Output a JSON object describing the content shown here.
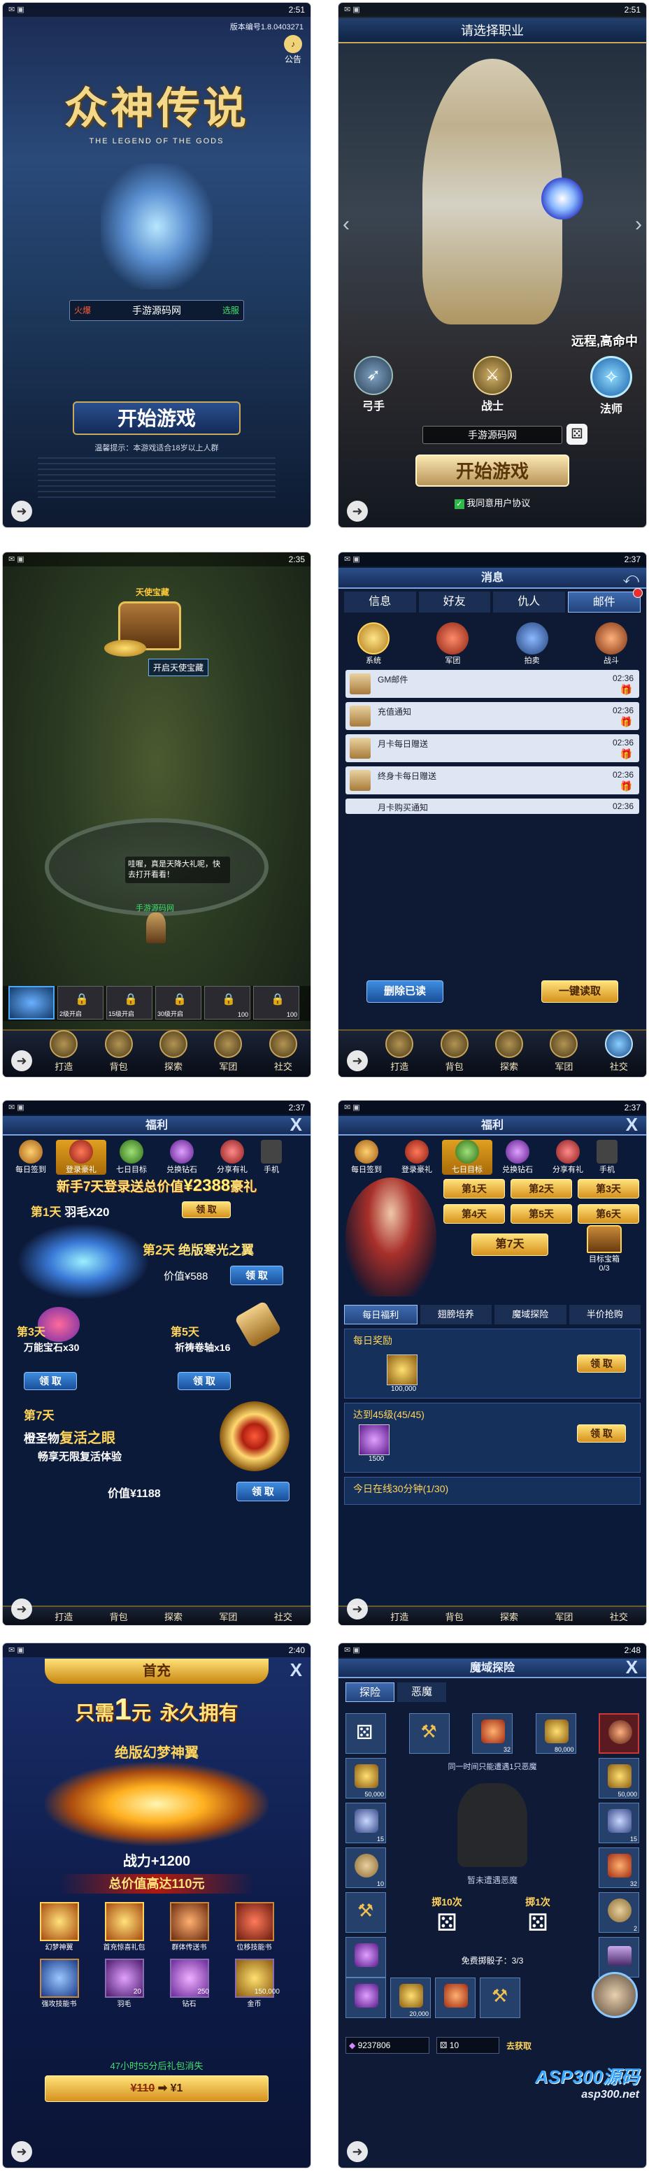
{
  "s1": {
    "time": "2:51",
    "version": "版本编号1.8.0403271",
    "notice": "公告",
    "logo_cn": "众神传说",
    "logo_en": "THE LEGEND OF THE GODS",
    "server_hot": "火爆",
    "server_name": "手游源码网",
    "server_switch": "选服",
    "start": "开始游戏",
    "tips": "温馨提示：本游戏适合18岁以上人群"
  },
  "s2": {
    "time": "2:51",
    "title": "请选择职业",
    "class_desc": "远程,高命中",
    "classes": [
      "弓手",
      "战士",
      "法师"
    ],
    "player_name": "手游源码网",
    "start": "开始游戏",
    "agree": "我同意用户协议"
  },
  "s3": {
    "time": "2:35",
    "chest_title": "天使宝藏",
    "chest_button": "开启天使宝藏",
    "npc_dialog": "哇喔，真是天降大礼呢，快去打开看看！",
    "player_name": "手游源码网",
    "skill_levels": [
      "",
      "2级开启",
      "15级开启",
      "30级开启",
      "100",
      "100"
    ],
    "bottom": [
      "打造",
      "背包",
      "探索",
      "军团",
      "社交"
    ]
  },
  "s4": {
    "time": "2:37",
    "title": "消息",
    "tabs": [
      "信息",
      "好友",
      "仇人",
      "邮件"
    ],
    "categories": [
      "系统",
      "军团",
      "拍卖",
      "战斗"
    ],
    "mails": [
      {
        "title": "GM邮件",
        "time": "02:36"
      },
      {
        "title": "充值通知",
        "time": "02:36"
      },
      {
        "title": "月卡每日赠送",
        "time": "02:36"
      },
      {
        "title": "终身卡每日赠送",
        "time": "02:36"
      },
      {
        "title": "月卡购买通知",
        "time": "02:36"
      }
    ],
    "delete_read": "删除已读",
    "read_all": "一键读取",
    "bottom": [
      "打造",
      "背包",
      "探索",
      "军团",
      "社交"
    ]
  },
  "s5": {
    "time": "2:37",
    "title": "福利",
    "tabs": [
      "每日签到",
      "登录豪礼",
      "七日目标",
      "兑换钻石",
      "分享有礼",
      "手机"
    ],
    "banner_prefix": "新手7天登录送总价值",
    "banner_value": "¥2388",
    "banner_suffix": "豪礼",
    "day1": "第1天",
    "day1_item": "羽毛X20",
    "claim": "领 取",
    "day2": "第2天",
    "day2_item": "绝版寒光之翼",
    "day2_price": "价值¥588",
    "day3": "第3天",
    "day3_item": "万能宝石x30",
    "day5": "第5天",
    "day5_item": "祈祷卷轴x16",
    "day7": "第7天",
    "day7_item1": "橙圣物",
    "day7_item2": "复活之眼",
    "day7_desc": "畅享无限复活体验",
    "day7_price": "价值¥1188",
    "bottom": [
      "打造",
      "背包",
      "探索",
      "军团",
      "社交"
    ]
  },
  "s6": {
    "time": "2:37",
    "title": "福利",
    "tabs": [
      "每日签到",
      "登录豪礼",
      "七日目标",
      "兑换钻石",
      "分享有礼",
      "手机"
    ],
    "days": [
      "第1天",
      "第2天",
      "第3天",
      "第4天",
      "第5天",
      "第6天"
    ],
    "day7": "第7天",
    "chest_label": "目标宝箱",
    "chest_count": "0/3",
    "subtabs": [
      "每日福利",
      "翅膀培养",
      "魔域探险",
      "半价抢购"
    ],
    "tasks": [
      {
        "title": "每日奖励",
        "qty": "100,000",
        "claim": "领 取"
      },
      {
        "title": "达到45级(45/45)",
        "qty": "1500",
        "claim": "领 取"
      },
      {
        "title": "今日在线30分钟(1/30)",
        "qty": "",
        "claim": ""
      }
    ],
    "bottom": [
      "打造",
      "背包",
      "探索",
      "军团",
      "社交"
    ]
  },
  "s7": {
    "time": "2:40",
    "title": "首充",
    "headline_a": "只需",
    "headline_num": "1",
    "headline_b": "元",
    "headline_c": "永久拥有",
    "wing_name": "绝版幻梦神翼",
    "power": "战力+1200",
    "total": "总价值高达110元",
    "items": [
      {
        "name": "幻梦神翼",
        "qty": ""
      },
      {
        "name": "首充惊喜礼包",
        "qty": ""
      },
      {
        "name": "群体传送书",
        "qty": ""
      },
      {
        "name": "位移技能书",
        "qty": ""
      },
      {
        "name": "强攻技能书",
        "qty": ""
      },
      {
        "name": "羽毛",
        "qty": "20"
      },
      {
        "name": "钻石",
        "qty": "250"
      },
      {
        "name": "金币",
        "qty": "150,000"
      }
    ],
    "countdown": "47小时55分后礼包消失",
    "old_price": "¥110",
    "new_price": "¥1"
  },
  "s8": {
    "time": "2:48",
    "title": "魔域探险",
    "tabs": [
      "探险",
      "恶魔"
    ],
    "notice": "同一时间只能遭遇1只恶魔",
    "empty": "暂未遭遇恶魔",
    "roll10": "掷10次",
    "roll1": "掷1次",
    "free": "免费掷骰子：3/3",
    "grid_top": [
      "",
      "",
      "32",
      "80,000",
      ""
    ],
    "grid_bottom": [
      "",
      "20,000",
      "",
      "",
      ""
    ],
    "grid_left": [
      "50,000",
      "15",
      "10",
      "",
      ""
    ],
    "grid_right": [
      "50,000",
      "15",
      "32",
      "2",
      ""
    ],
    "diamonds": "9237806",
    "dice": "10",
    "go": "去获取",
    "watermark": "ASP300源码",
    "watermark_url": "asp300.net"
  }
}
